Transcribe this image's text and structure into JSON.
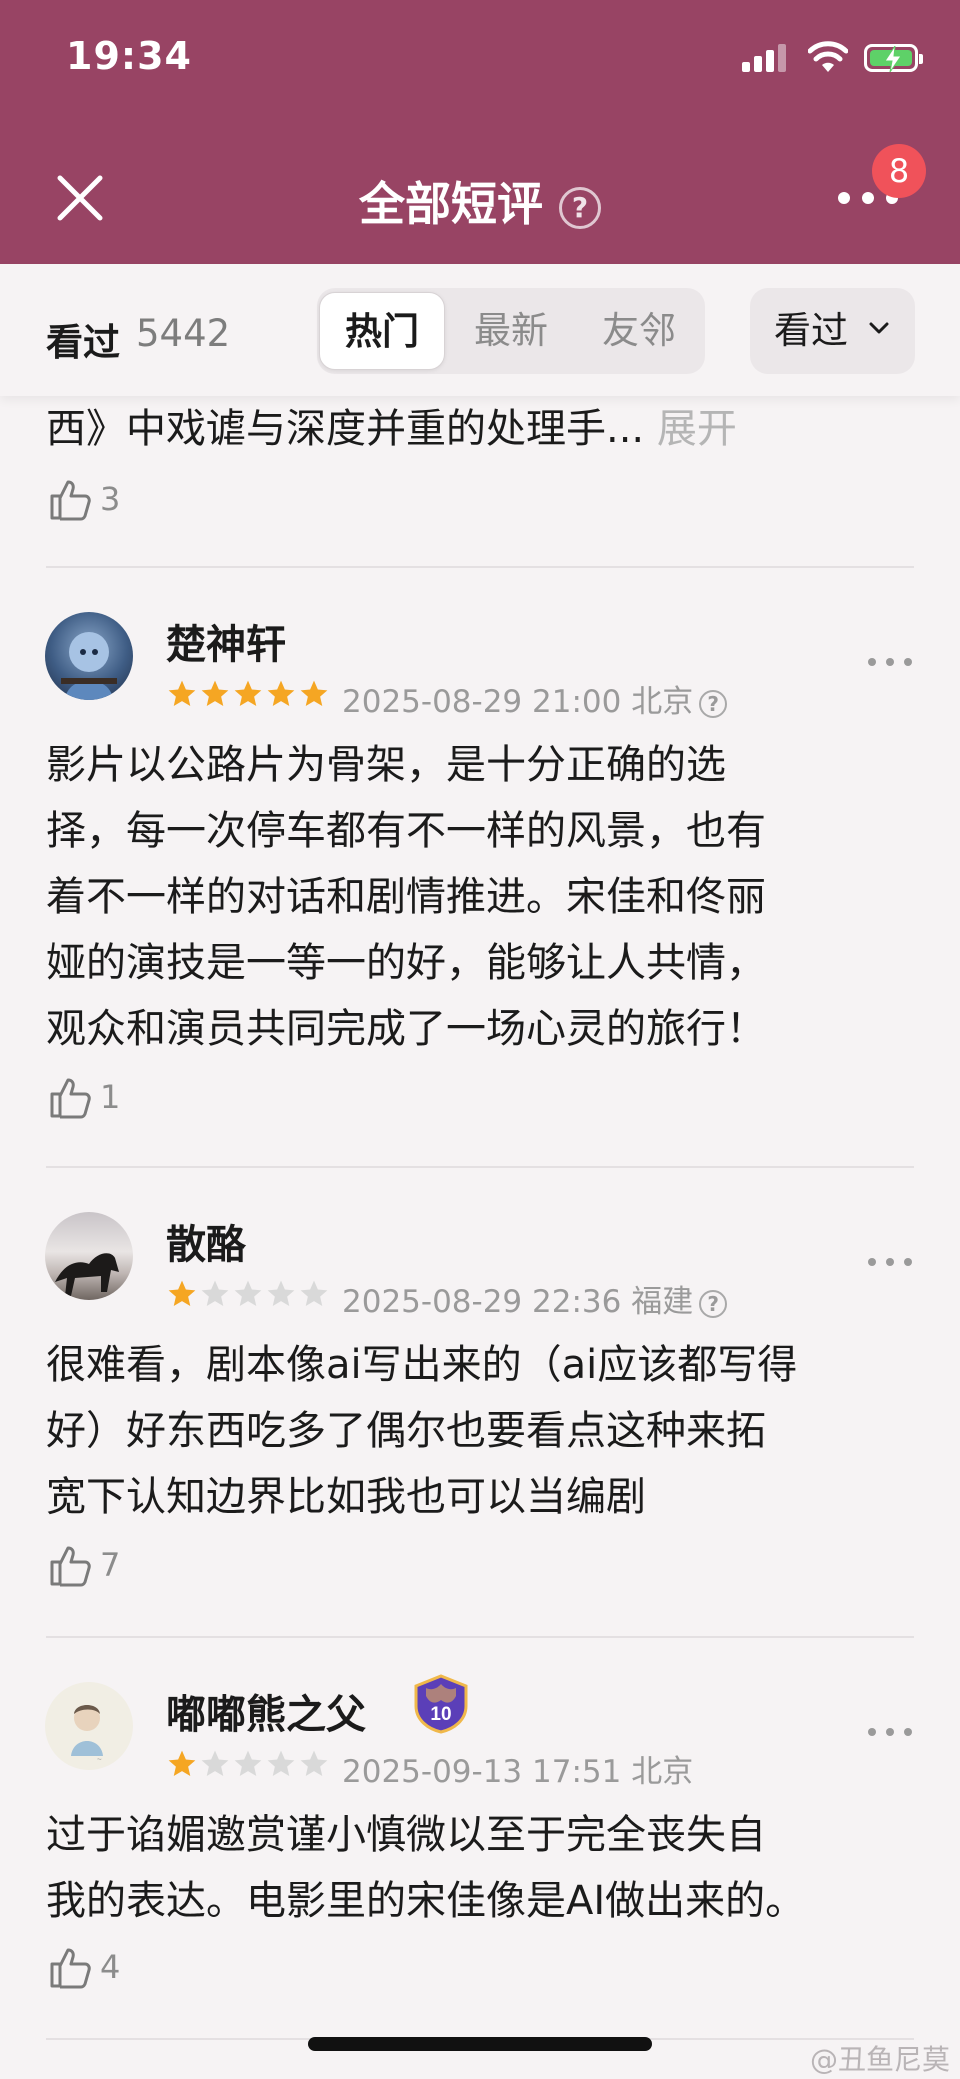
{
  "status_bar": {
    "time": "19:34"
  },
  "header": {
    "title": "全部短评",
    "help_glyph": "?",
    "badge_count": "8"
  },
  "filter": {
    "seen_label": "看过",
    "seen_count": "5442",
    "tabs": [
      {
        "label": "热门",
        "active": true
      },
      {
        "label": "最新",
        "active": false
      },
      {
        "label": "友邻",
        "active": false
      }
    ],
    "dropdown_label": "看过"
  },
  "partial_review": {
    "text_tail": "西》中戏谑与深度并重的处理手...",
    "expand_label": "展开",
    "likes": "3"
  },
  "reviews": [
    {
      "username": "楚神轩",
      "rating": 5,
      "datetime": "2025-08-29 21:00",
      "location": "北京",
      "has_help": true,
      "lines": [
        "影片以公路片为骨架，是十分正确的选",
        "择，每一次停车都有不一样的风景，也有",
        "着不一样的对话和剧情推进。宋佳和佟丽",
        "娅的演技是一等一的好，能够让人共情，",
        "观众和演员共同完成了一场心灵的旅行！"
      ],
      "likes": "1"
    },
    {
      "username": "散酪",
      "rating": 1,
      "datetime": "2025-08-29 22:36",
      "location": "福建",
      "has_help": true,
      "lines": [
        "很难看，剧本像ai写出来的（ai应该都写得",
        "好）好东西吃多了偶尔也要看点这种来拓",
        "宽下认知边界比如我也可以当编剧"
      ],
      "likes": "7"
    },
    {
      "username": "嘟嘟熊之父",
      "badge_level": "10",
      "rating": 1,
      "datetime": "2025-09-13 17:51",
      "location": "北京",
      "has_help": false,
      "lines": [
        "过于谄媚邀赏谨小慎微以至于完全丧失自",
        "我的表达。电影里的宋佳像是AI做出来的。"
      ],
      "likes": "4"
    }
  ],
  "watermark": "@丑鱼尼莫",
  "colors": {
    "header_bg": "#984464",
    "star_on": "#f5a623",
    "star_off": "#d9d9d9",
    "badge": "#f0525a"
  }
}
